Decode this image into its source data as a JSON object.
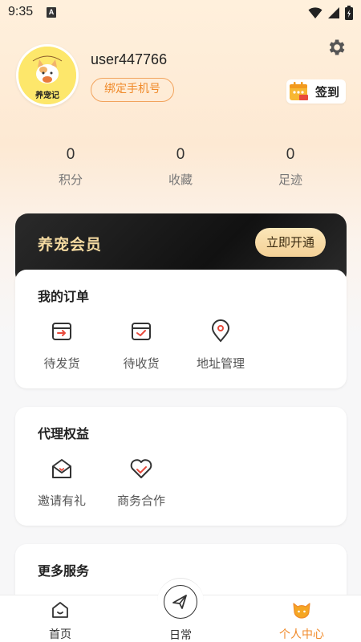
{
  "status_bar": {
    "time": "9:35",
    "notif_letter": "A"
  },
  "profile": {
    "avatar_text": "养宠记",
    "username": "user447766",
    "bind_phone_label": "绑定手机号",
    "checkin_label": "签到"
  },
  "stats": [
    {
      "value": "0",
      "label": "积分"
    },
    {
      "value": "0",
      "label": "收藏"
    },
    {
      "value": "0",
      "label": "足迹"
    }
  ],
  "vip": {
    "title": "养宠会员",
    "button_label": "立即开通"
  },
  "orders": {
    "title": "我的订单",
    "items": [
      {
        "label": "待发货",
        "icon": "box-arrow-icon"
      },
      {
        "label": "待收货",
        "icon": "box-check-icon"
      },
      {
        "label": "地址管理",
        "icon": "location-pin-icon"
      }
    ]
  },
  "agent": {
    "title": "代理权益",
    "items": [
      {
        "label": "邀请有礼",
        "icon": "gift-envelope-icon"
      },
      {
        "label": "商务合作",
        "icon": "handshake-heart-icon"
      }
    ]
  },
  "more": {
    "title": "更多服务"
  },
  "bottom_nav": {
    "items": [
      {
        "label": "首页",
        "icon": "home-icon"
      },
      {
        "label": "日常",
        "icon": "paper-plane-icon"
      },
      {
        "label": "个人中心",
        "icon": "cat-face-icon"
      }
    ],
    "active_color": "#f08a2a"
  },
  "colors": {
    "accent": "#f08a2a",
    "vip_gold": "#f3d9a0",
    "vip_bg": "#1a1a1a"
  }
}
